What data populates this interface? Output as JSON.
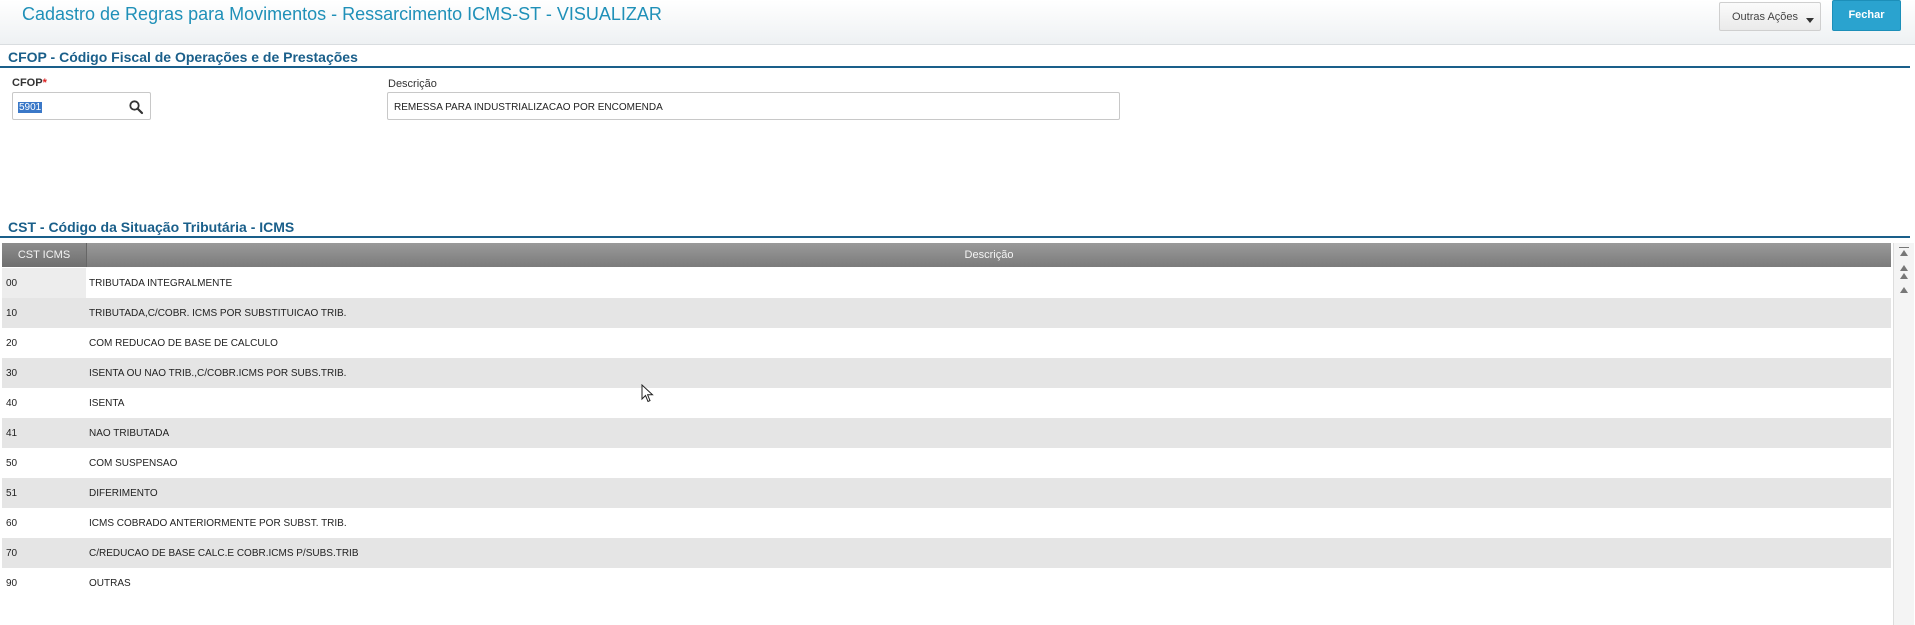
{
  "header": {
    "title": "Cadastro de Regras para Movimentos - Ressarcimento ICMS-ST - VISUALIZAR",
    "other_actions_label": "Outras Ações",
    "close_label": "Fechar"
  },
  "cfop_section": {
    "title": "CFOP - Código Fiscal de Operações e de Prestações",
    "cfop_label": "CFOP",
    "required_mark": "*",
    "cfop_value": "5901",
    "description_label": "Descrição",
    "description_value": "REMESSA PARA INDUSTRIALIZACAO POR ENCOMENDA"
  },
  "cst_section": {
    "title": "CST - Código da Situação Tributária - ICMS",
    "columns": [
      "CST ICMS",
      "Descrição"
    ],
    "rows": [
      {
        "code": "00",
        "desc": "TRIBUTADA INTEGRALMENTE"
      },
      {
        "code": "10",
        "desc": "TRIBUTADA,C/COBR. ICMS POR SUBSTITUICAO TRIB."
      },
      {
        "code": "20",
        "desc": "COM REDUCAO DE BASE DE CALCULO"
      },
      {
        "code": "30",
        "desc": "ISENTA OU NAO TRIB.,C/COBR.ICMS POR SUBS.TRIB."
      },
      {
        "code": "40",
        "desc": "ISENTA"
      },
      {
        "code": "41",
        "desc": "NAO TRIBUTADA"
      },
      {
        "code": "50",
        "desc": "COM SUSPENSAO"
      },
      {
        "code": "51",
        "desc": "DIFERIMENTO"
      },
      {
        "code": "60",
        "desc": "ICMS COBRADO ANTERIORMENTE POR SUBST. TRIB."
      },
      {
        "code": "70",
        "desc": "C/REDUCAO DE BASE CALC.E COBR.ICMS P/SUBS.TRIB"
      },
      {
        "code": "90",
        "desc": "OUTRAS"
      }
    ]
  },
  "icons": {
    "search": "search-icon",
    "dropdown": "chevron-down-icon",
    "scroll_up": "arrow-up-icon",
    "scroll_top": "scroll-top-icon",
    "cursor": "mouse-pointer-icon"
  },
  "colors": {
    "accent": "#1f90b8",
    "close_button": "#2aa3cf",
    "section_title": "#1a5f8a",
    "selection": "#3a78c8"
  }
}
